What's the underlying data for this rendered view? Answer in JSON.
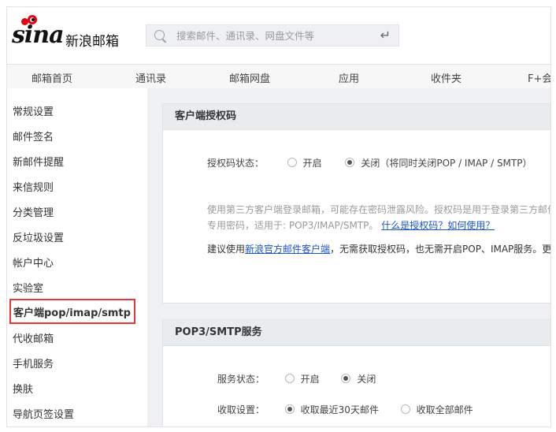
{
  "header": {
    "logo_text": "sina",
    "logo_cn": "新浪邮箱",
    "search_placeholder": "搜索邮件、通讯录、网盘文件等",
    "enter_glyph": "↵"
  },
  "nav": {
    "tabs": [
      "邮箱首页",
      "通讯录",
      "邮箱网盘",
      "应用",
      "收件夹",
      "F+会"
    ]
  },
  "sidebar": {
    "items": [
      "常规设置",
      "邮件签名",
      "新邮件提醒",
      "来信规则",
      "分类管理",
      "反垃圾设置",
      "帐户中心",
      "实验室",
      "客户端pop/imap/smtp",
      "代收邮箱",
      "手机服务",
      "换肤",
      "导航页签设置"
    ],
    "active_index": 8
  },
  "auth_card": {
    "title": "客户端授权码",
    "status_label": "授权码状态：",
    "opt_on": "开启",
    "opt_off": "关闭（将同时关闭POP / IMAP / SMTP）",
    "selected": "off",
    "desc_line1": "使用第三方客户端登录邮箱，可能存在密码泄露风险。授权码是用于登录第三方邮件",
    "desc_line2_prefix": "专用密码，适用于: POP3/IMAP/SMTP。",
    "desc_link": "什么是授权码？如何使用？",
    "tip_prefix": "建议使用",
    "tip_link": "新浪官方邮件客户端",
    "tip_suffix": "，无需获取授权码，也无需开启POP、IMAP服务。更"
  },
  "pop_card": {
    "title": "POP3/SMTP服务",
    "status_label": "服务状态：",
    "opt_on": "开启",
    "opt_off": "关闭",
    "selected": "off",
    "receive_label": "收取设置：",
    "opt_recent": "收取最近30天邮件",
    "opt_all": "收取全部邮件",
    "receive_selected": "recent"
  },
  "colors": {
    "accent_red": "#e53935",
    "link_blue": "#1a55c6",
    "panel_gray": "#eef0f3"
  }
}
